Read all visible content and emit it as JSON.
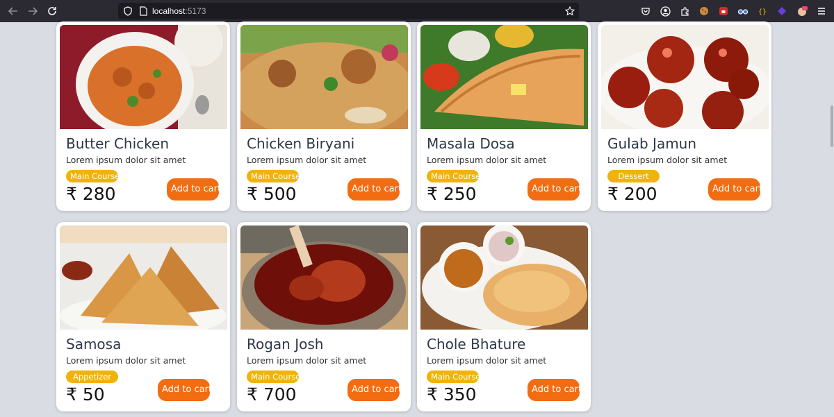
{
  "browser": {
    "url_host": "localhost",
    "url_port": ":5173"
  },
  "products": [
    {
      "name": "Butter Chicken",
      "description": "Lorem ipsum dolor sit amet",
      "category": "Main Course",
      "price": "₹ 280",
      "button": "Add to cart"
    },
    {
      "name": "Chicken Biryani",
      "description": "Lorem ipsum dolor sit amet",
      "category": "Main Course",
      "price": "₹ 500",
      "button": "Add to cart"
    },
    {
      "name": "Masala Dosa",
      "description": "Lorem ipsum dolor sit amet",
      "category": "Main Course",
      "price": "₹ 250",
      "button": "Add to cart"
    },
    {
      "name": "Gulab Jamun",
      "description": "Lorem ipsum dolor sit amet",
      "category": "Dessert",
      "price": "₹ 200",
      "button": "Add to cart"
    },
    {
      "name": "Samosa",
      "description": "Lorem ipsum dolor sit amet",
      "category": "Appetizer",
      "price": "₹ 50",
      "button": "Add to cart"
    },
    {
      "name": "Rogan Josh",
      "description": "Lorem ipsum dolor sit amet",
      "category": "Main Course",
      "price": "₹ 700",
      "button": "Add to cart"
    },
    {
      "name": "Chole Bhature",
      "description": "Lorem ipsum dolor sit amet",
      "category": "Main Course",
      "price": "₹ 350",
      "button": "Add to cart"
    }
  ],
  "colors": {
    "accent_button": "#f26c12",
    "badge": "#f0b30a",
    "page_background": "#d9dce3",
    "browser_toolbar": "#2b2a33"
  }
}
